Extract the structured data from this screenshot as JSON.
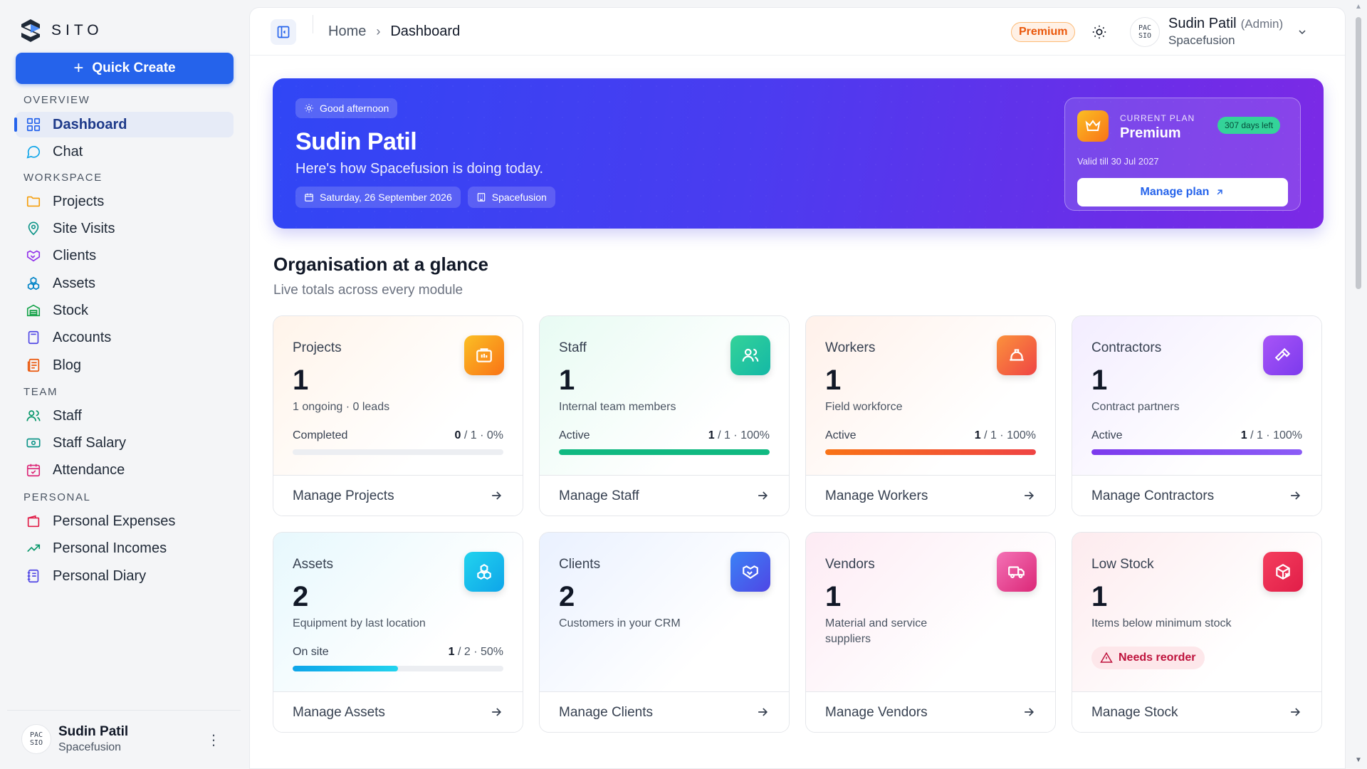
{
  "app": {
    "logo_text": "SITO"
  },
  "sidebar": {
    "quick_create_label": "Quick Create",
    "sections": {
      "overview": "OVERVIEW",
      "workspace": "WORKSPACE",
      "team": "TEAM",
      "personal": "PERSONAL"
    },
    "items": [
      {
        "label": "Dashboard",
        "icon": "dashboard-icon",
        "active": true
      },
      {
        "label": "Chat",
        "icon": "chat-icon"
      },
      {
        "label": "Projects",
        "icon": "folder-icon"
      },
      {
        "label": "Site Visits",
        "icon": "map-pin-icon"
      },
      {
        "label": "Clients",
        "icon": "handshake-icon"
      },
      {
        "label": "Assets",
        "icon": "boxes-icon"
      },
      {
        "label": "Stock",
        "icon": "warehouse-icon"
      },
      {
        "label": "Accounts",
        "icon": "calculator-icon"
      },
      {
        "label": "Blog",
        "icon": "newspaper-icon"
      },
      {
        "label": "Staff",
        "icon": "users-icon"
      },
      {
        "label": "Staff Salary",
        "icon": "banknote-icon"
      },
      {
        "label": "Attendance",
        "icon": "calendar-check-icon"
      },
      {
        "label": "Personal Expenses",
        "icon": "wallet-icon"
      },
      {
        "label": "Personal Incomes",
        "icon": "trending-up-icon"
      },
      {
        "label": "Personal Diary",
        "icon": "notebook-icon"
      }
    ],
    "user": {
      "name": "Sudin Patil",
      "org": "Spacefusion",
      "avatar_text": "PAC\nSIO"
    }
  },
  "topbar": {
    "breadcrumb": {
      "home": "Home",
      "current": "Dashboard"
    },
    "premium_badge": "Premium",
    "user": {
      "name": "Sudin Patil",
      "role": "(Admin)",
      "org": "Spacefusion"
    }
  },
  "hero": {
    "greeting": "Good afternoon",
    "name": "Sudin Patil",
    "subtitle": "Here's how Spacefusion is doing today.",
    "date": "Saturday, 26 September 2026",
    "org": "Spacefusion",
    "plan": {
      "label": "CURRENT PLAN",
      "name": "Premium",
      "days_left": "307 days left",
      "valid_till": "Valid till 30 Jul 2027",
      "manage_label": "Manage plan"
    }
  },
  "section": {
    "title": "Organisation at a glance",
    "subtitle": "Live totals across every module"
  },
  "cards": [
    {
      "title": "Projects",
      "value": "1",
      "desc": "1 ongoing · 0 leads",
      "stat_label": "Completed",
      "stat_num": "0",
      "stat_rest": " / 1 · 0%",
      "progress": 0,
      "bar_color": "#f97316",
      "icon": "briefcase-icon",
      "icon_bg": "linear-gradient(135deg,#fbbf24,#f97316)",
      "tint": "linear-gradient(135deg,#fff4ea 0%,#ffffff 70%)",
      "footer": "Manage Projects"
    },
    {
      "title": "Staff",
      "value": "1",
      "desc": "Internal team members",
      "stat_label": "Active",
      "stat_num": "1",
      "stat_rest": " / 1 · 100%",
      "progress": 1,
      "bar_color": "#10b981",
      "icon": "users-icon",
      "icon_bg": "linear-gradient(135deg,#34d399,#14b8a6)",
      "tint": "linear-gradient(135deg,#e8fbf3 0%,#ffffff 70%)",
      "footer": "Manage Staff"
    },
    {
      "title": "Workers",
      "value": "1",
      "desc": "Field workforce",
      "stat_label": "Active",
      "stat_num": "1",
      "stat_rest": " / 1 · 100%",
      "progress": 1,
      "bar_color": "linear-gradient(90deg,#f97316,#ef4444)",
      "icon": "hard-hat-icon",
      "icon_bg": "linear-gradient(135deg,#fb923c,#ef4444)",
      "tint": "linear-gradient(135deg,#fff1ea 0%,#ffffff 70%)",
      "footer": "Manage Workers"
    },
    {
      "title": "Contractors",
      "value": "1",
      "desc": "Contract partners",
      "stat_label": "Active",
      "stat_num": "1",
      "stat_rest": " / 1 · 100%",
      "progress": 1,
      "bar_color": "linear-gradient(90deg,#7c3aed,#8b5cf6)",
      "icon": "hammer-icon",
      "icon_bg": "linear-gradient(135deg,#a855f7,#7c3aed)",
      "tint": "linear-gradient(135deg,#f3edff 0%,#ffffff 70%)",
      "footer": "Manage Contractors"
    },
    {
      "title": "Assets",
      "value": "2",
      "desc": "Equipment by last location",
      "stat_label": "On site",
      "stat_num": "1",
      "stat_rest": " / 2 · 50%",
      "progress": 0.5,
      "bar_color": "linear-gradient(90deg,#0ea5e9,#22d3ee)",
      "icon": "boxes-icon",
      "icon_bg": "linear-gradient(135deg,#22d3ee,#0ea5e9)",
      "tint": "linear-gradient(135deg,#e7f8fd 0%,#ffffff 70%)",
      "footer": "Manage Assets"
    },
    {
      "title": "Clients",
      "value": "2",
      "desc": "Customers in your CRM",
      "icon": "handshake-icon",
      "icon_bg": "linear-gradient(135deg,#3b82f6,#4f46e5)",
      "tint": "linear-gradient(135deg,#eaf1ff 0%,#ffffff 70%)",
      "footer": "Manage Clients"
    },
    {
      "title": "Vendors",
      "value": "1",
      "desc": "Material and service suppliers",
      "icon": "truck-icon",
      "icon_bg": "linear-gradient(135deg,#f472b6,#db2777)",
      "tint": "linear-gradient(135deg,#fdebf4 0%,#ffffff 70%)",
      "footer": "Manage Vendors"
    },
    {
      "title": "Low Stock",
      "value": "1",
      "desc": "Items below minimum stock",
      "badge": "Needs reorder",
      "icon": "package-x-icon",
      "icon_bg": "linear-gradient(135deg,#f43f5e,#e11d48)",
      "tint": "linear-gradient(135deg,#fdebee 0%,#ffffff 70%)",
      "footer": "Manage Stock"
    }
  ]
}
